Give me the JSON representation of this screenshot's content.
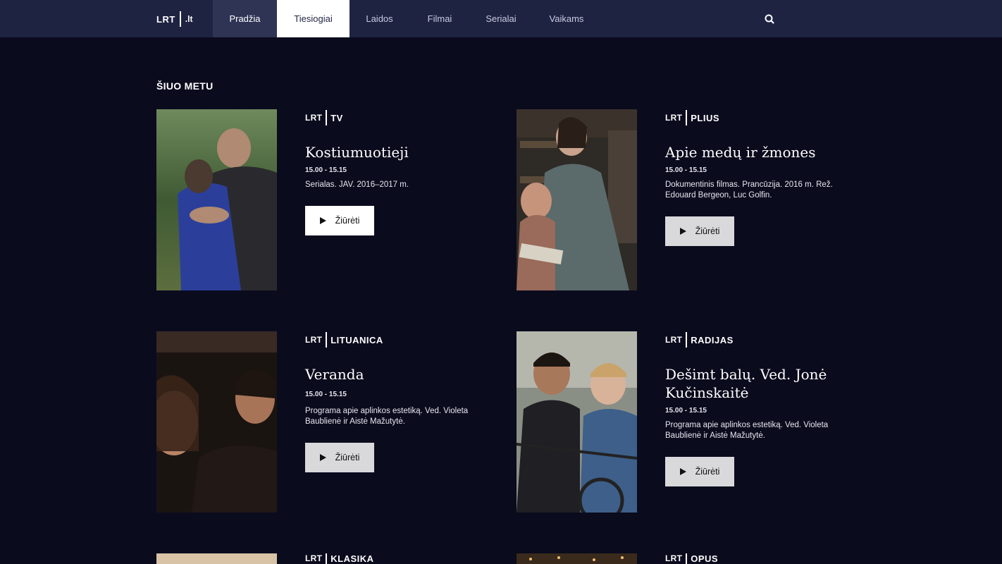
{
  "nav": {
    "logo_brand": "LRT",
    "logo_tld": ".lt",
    "items": [
      {
        "label": "Pradžia"
      },
      {
        "label": "Tiesiogiai"
      },
      {
        "label": "Laidos"
      },
      {
        "label": "Filmai"
      },
      {
        "label": "Serialai"
      },
      {
        "label": "Vaikams"
      }
    ],
    "search_icon": "search-icon"
  },
  "section": {
    "title": "ŠIUO METU"
  },
  "cards": [
    {
      "channel_brand": "LRT",
      "channel": "TV",
      "title": "Kostiumuotieji",
      "time": "15.00 - 15.15",
      "desc": "Serialas. JAV. 2016–2017 m.",
      "button": "Žiūrėti"
    },
    {
      "channel_brand": "LRT",
      "channel": "PLIUS",
      "title": "Apie medų ir žmones",
      "time": "15.00 - 15.15",
      "desc": "Dokumentinis filmas. Prancūzija. 2016 m. Rež. Edouard Bergeon, Luc Golfin.",
      "button": "Žiūrėti"
    },
    {
      "channel_brand": "LRT",
      "channel": "LITUANICA",
      "title": "Veranda",
      "time": "15.00 - 15.15",
      "desc": "Programa apie aplinkos estetiką. Ved. Violeta Baublienė ir Aistė Mažutytė.",
      "button": "Žiūrėti"
    },
    {
      "channel_brand": "LRT",
      "channel": "RADIJAS",
      "title": "Dešimt balų. Ved. Jonė Kučinskaitė",
      "time": "15.00 - 15.15",
      "desc": "Programa apie aplinkos estetiką. Ved. Violeta Baublienė ir Aistė Mažutytė.",
      "button": "Žiūrėti"
    },
    {
      "channel_brand": "LRT",
      "channel": "KLASIKA"
    },
    {
      "channel_brand": "LRT",
      "channel": "OPUS"
    }
  ]
}
